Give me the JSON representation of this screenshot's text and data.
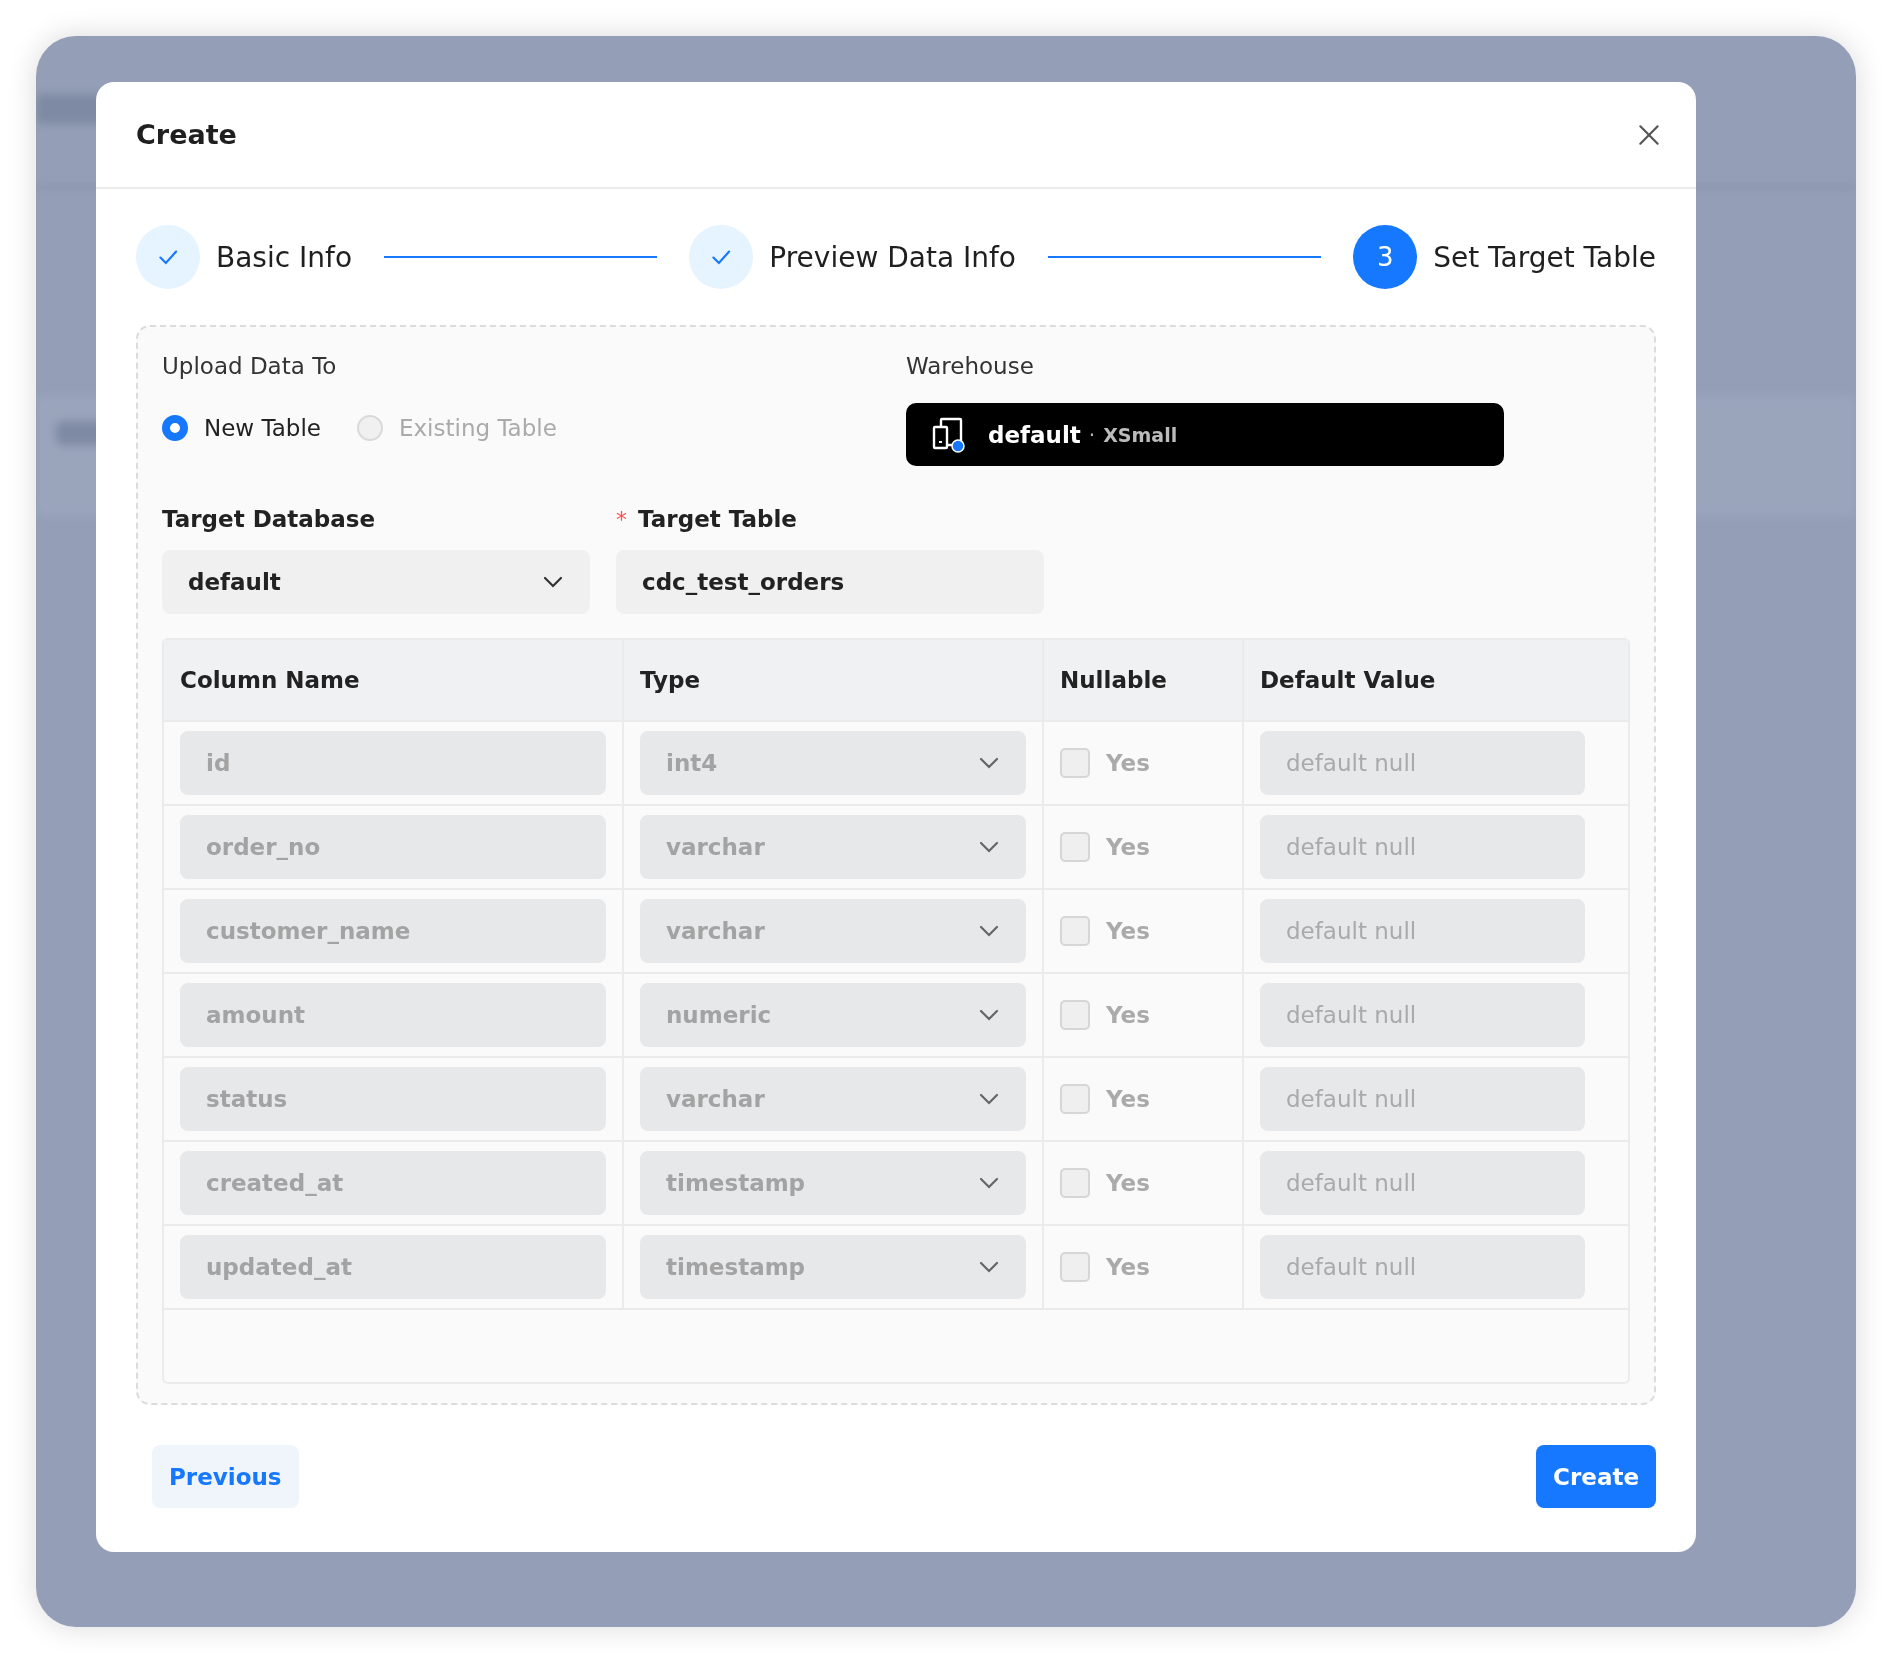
{
  "dialog": {
    "title": "Create"
  },
  "steps": [
    {
      "label": "Basic Info",
      "done": true
    },
    {
      "label": "Preview Data Info",
      "done": true
    },
    {
      "label": "Set Target Table",
      "done": false,
      "number": "3"
    }
  ],
  "upload_to": {
    "label": "Upload Data To",
    "options": [
      {
        "label": "New Table",
        "selected": true,
        "disabled": false
      },
      {
        "label": "Existing Table",
        "selected": false,
        "disabled": true
      }
    ]
  },
  "warehouse": {
    "label": "Warehouse",
    "name": "default",
    "separator": "·",
    "size": "XSmall"
  },
  "target_database": {
    "label": "Target Database",
    "value": "default"
  },
  "target_table": {
    "label": "Target Table",
    "required_mark": "*",
    "value": "cdc_test_orders"
  },
  "table": {
    "columns": [
      "Column Name",
      "Type",
      "Nullable",
      "Default Value"
    ],
    "rows": [
      {
        "name": "id",
        "type": "int4",
        "nullable": false,
        "nullable_label": "Yes",
        "default_placeholder": "default null"
      },
      {
        "name": "order_no",
        "type": "varchar",
        "nullable": false,
        "nullable_label": "Yes",
        "default_placeholder": "default null"
      },
      {
        "name": "customer_name",
        "type": "varchar",
        "nullable": false,
        "nullable_label": "Yes",
        "default_placeholder": "default null"
      },
      {
        "name": "amount",
        "type": "numeric",
        "nullable": false,
        "nullable_label": "Yes",
        "default_placeholder": "default null"
      },
      {
        "name": "status",
        "type": "varchar",
        "nullable": false,
        "nullable_label": "Yes",
        "default_placeholder": "default null"
      },
      {
        "name": "created_at",
        "type": "timestamp",
        "nullable": false,
        "nullable_label": "Yes",
        "default_placeholder": "default null"
      },
      {
        "name": "updated_at",
        "type": "timestamp",
        "nullable": false,
        "nullable_label": "Yes",
        "default_placeholder": "default null"
      }
    ]
  },
  "buttons": {
    "previous": "Previous",
    "create": "Create"
  }
}
